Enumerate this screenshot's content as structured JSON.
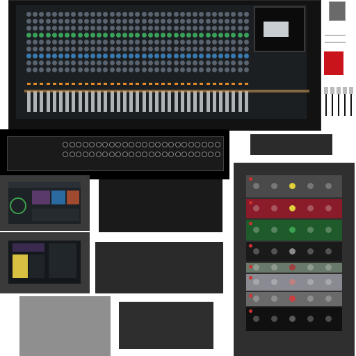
{
  "title": "",
  "colors": {
    "mixer_body": "#121212",
    "fader_cap": "#aeb3b8",
    "meter_led": "#e08a2a",
    "swatch_red": "#c8141a",
    "swatch_gray": "#6a6a6a",
    "rack_bg": "#2f2f2f"
  },
  "atlas": {
    "mixer": {
      "name": "mixing-console-top",
      "channel_strips": 36
    },
    "rear_panel": {
      "name": "mixing-console-rear",
      "jack_count": 48
    },
    "swatches": [
      "gray-swatch",
      "line-swatch",
      "red-swatch",
      "fader-knob-swatch"
    ],
    "screens": [
      "daw-screen-1",
      "daw-screen-2"
    ],
    "blank_panels": [
      "blank-panel-1",
      "blank-panel-2",
      "blank-panel-3"
    ],
    "noise_texture": "gray-noise-texture",
    "rack": {
      "name": "rack-units",
      "units": [
        {
          "color": "#4a4a4a",
          "accent": "#e0d13a"
        },
        {
          "color": "#8a1c2a",
          "accent": "#e0d13a"
        },
        {
          "color": "#1f5a2a",
          "accent": "#3ba050"
        },
        {
          "color": "#1a1a1a",
          "accent": "#8a8a8a"
        },
        {
          "color": "#6a7a6a",
          "accent": "#a04040"
        },
        {
          "color": "#8a8a92",
          "accent": "#c08080"
        },
        {
          "color": "#6a6a6a",
          "accent": "#c84040"
        },
        {
          "color": "#101010",
          "accent": "#5a5a5a"
        }
      ]
    }
  }
}
